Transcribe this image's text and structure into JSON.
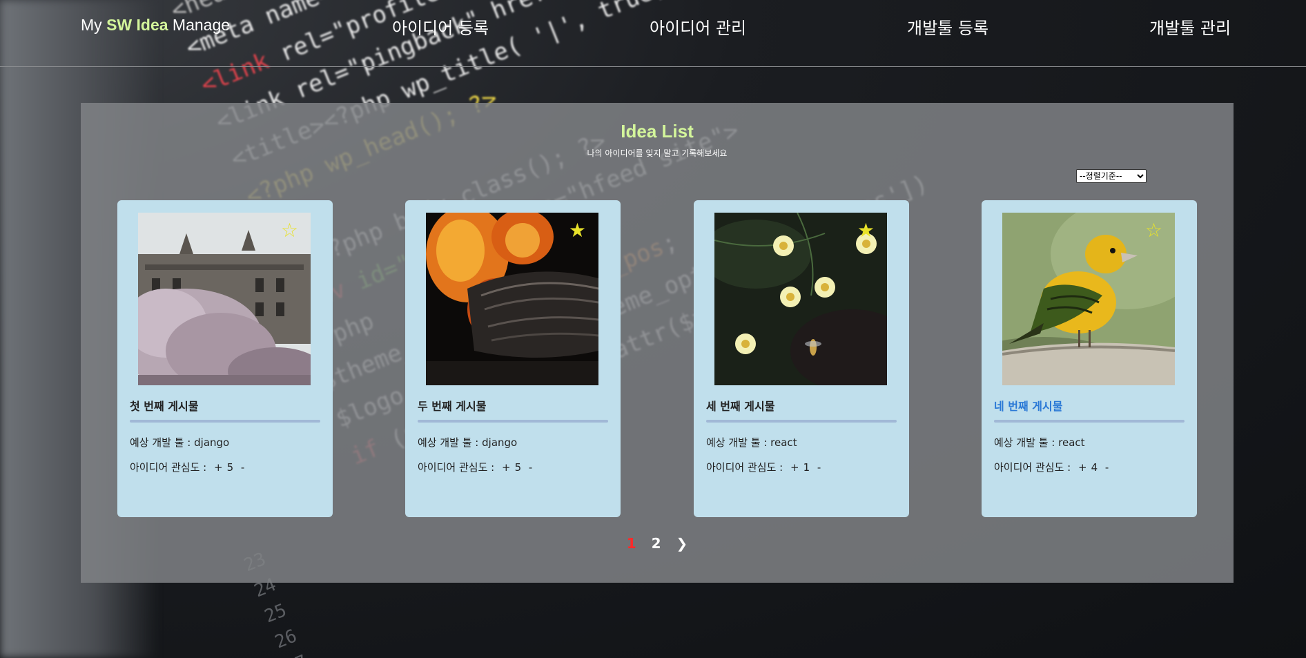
{
  "header": {
    "logo_prefix": "My ",
    "logo_highlight": "SW Idea",
    "logo_suffix": " Manage",
    "nav": [
      {
        "label": "아이디어 등록"
      },
      {
        "label": "아이디어 관리"
      },
      {
        "label": "개발툴 등록"
      },
      {
        "label": "개발툴 관리"
      }
    ]
  },
  "main": {
    "title": "Idea List",
    "subtitle": "나의 아이디어를 잊지 말고 기록해보세요",
    "sort_default": "--정렬기준--",
    "cards": [
      {
        "title": "첫 번째 게시물",
        "tool_label": "예상 개발 툴 : django",
        "interest_label": "아이디어 관심도 :",
        "plus": "+",
        "value": "5",
        "minus": "-",
        "star": "☆",
        "image": "castle-blossom-photo"
      },
      {
        "title": "두 번째 게시물",
        "tool_label": "예상 개발 툴 : django",
        "interest_label": "아이디어 관심도 :",
        "plus": "+",
        "value": "5",
        "minus": "-",
        "star": "★",
        "image": "fire-log-photo"
      },
      {
        "title": "세 번째 게시물",
        "tool_label": "예상 개발 툴 : react",
        "interest_label": "아이디어 관심도 :",
        "plus": "+",
        "value": "1",
        "minus": "-",
        "star": "★",
        "image": "flowers-photo"
      },
      {
        "title": "네 번째 게시물",
        "tool_label": "예상 개발 툴 : react",
        "interest_label": "아이디어 관심도 :",
        "plus": "+",
        "value": "4",
        "minus": "-",
        "star": "☆",
        "image": "yellow-bird-photo"
      }
    ],
    "pagination": {
      "pages": [
        "1",
        "2"
      ],
      "current": "1",
      "next": "❯"
    }
  },
  "colors": {
    "accent_green": "#d3f59b",
    "card_bg": "#c0dfec",
    "active_page": "#ff2a2a",
    "title_link": "#2b79d6",
    "star": "#e8e22a"
  }
}
